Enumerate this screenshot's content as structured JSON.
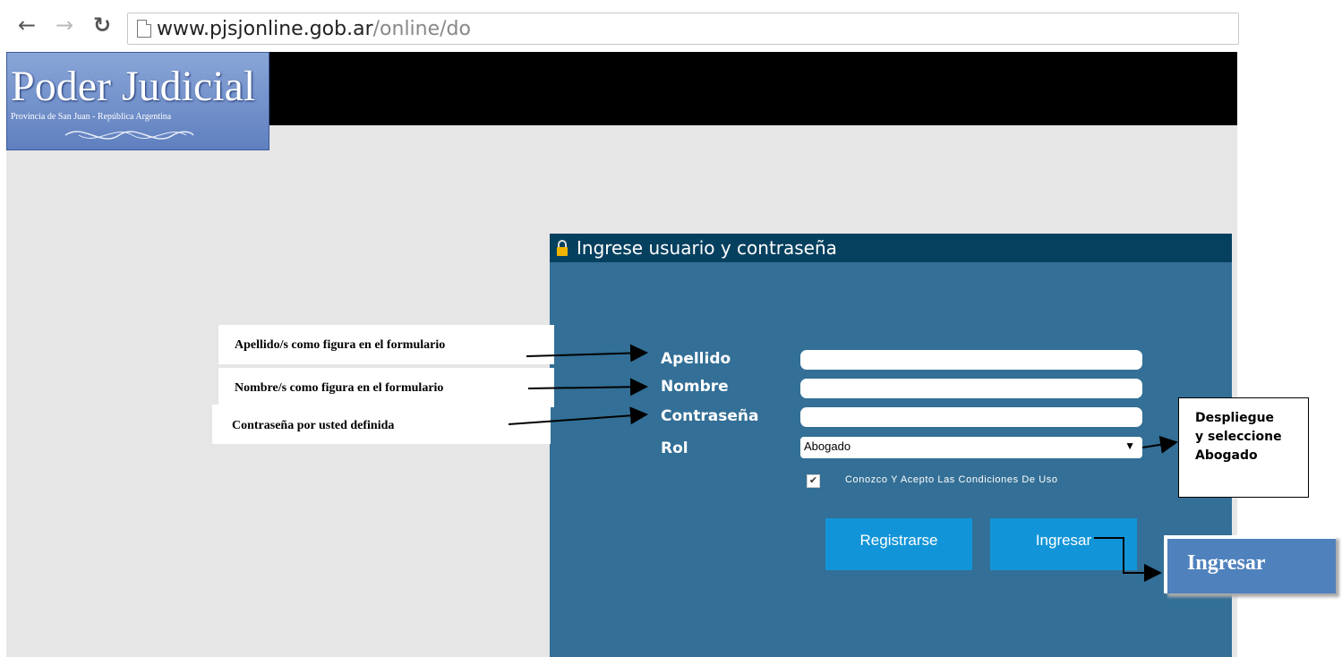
{
  "browser": {
    "url_domain": "www.pjsjonline.gob.ar",
    "url_path": "/online/do"
  },
  "header": {
    "logo_title": "Poder Judicial",
    "logo_subtitle": "Provincia de San Juan - República Argentina"
  },
  "login_panel": {
    "title": "Ingrese usuario y contraseña",
    "fields": {
      "apellido_label": "Apellido",
      "nombre_label": "Nombre",
      "password_label": "Contraseña",
      "rol_label": "Rol"
    },
    "rol_selected": "Abogado",
    "terms_label": "Conozco Y Acepto Las Condiciones De Uso",
    "terms_checked": true,
    "register_button": "Registrarse",
    "login_button": "Ingresar"
  },
  "annotations": {
    "apellido_note": "Apellido/s como figura en el formulario",
    "nombre_note": "Nombre/s como figura en el formulario",
    "password_note": "Contraseña por usted definida",
    "rol_note": [
      "Despliegue",
      "y seleccione",
      "Abogado"
    ],
    "ingresar_note": "Ingresar"
  },
  "icons": {
    "back": "back-arrow-icon",
    "forward": "forward-arrow-icon",
    "reload": "reload-icon",
    "page": "page-icon",
    "lock": "lock-icon",
    "checkmark": "checkmark-icon"
  },
  "colors": {
    "panel_header": "#06405f",
    "panel_body": "#336f96",
    "button": "#1295d8",
    "annotation_box": "#4f81bd"
  }
}
